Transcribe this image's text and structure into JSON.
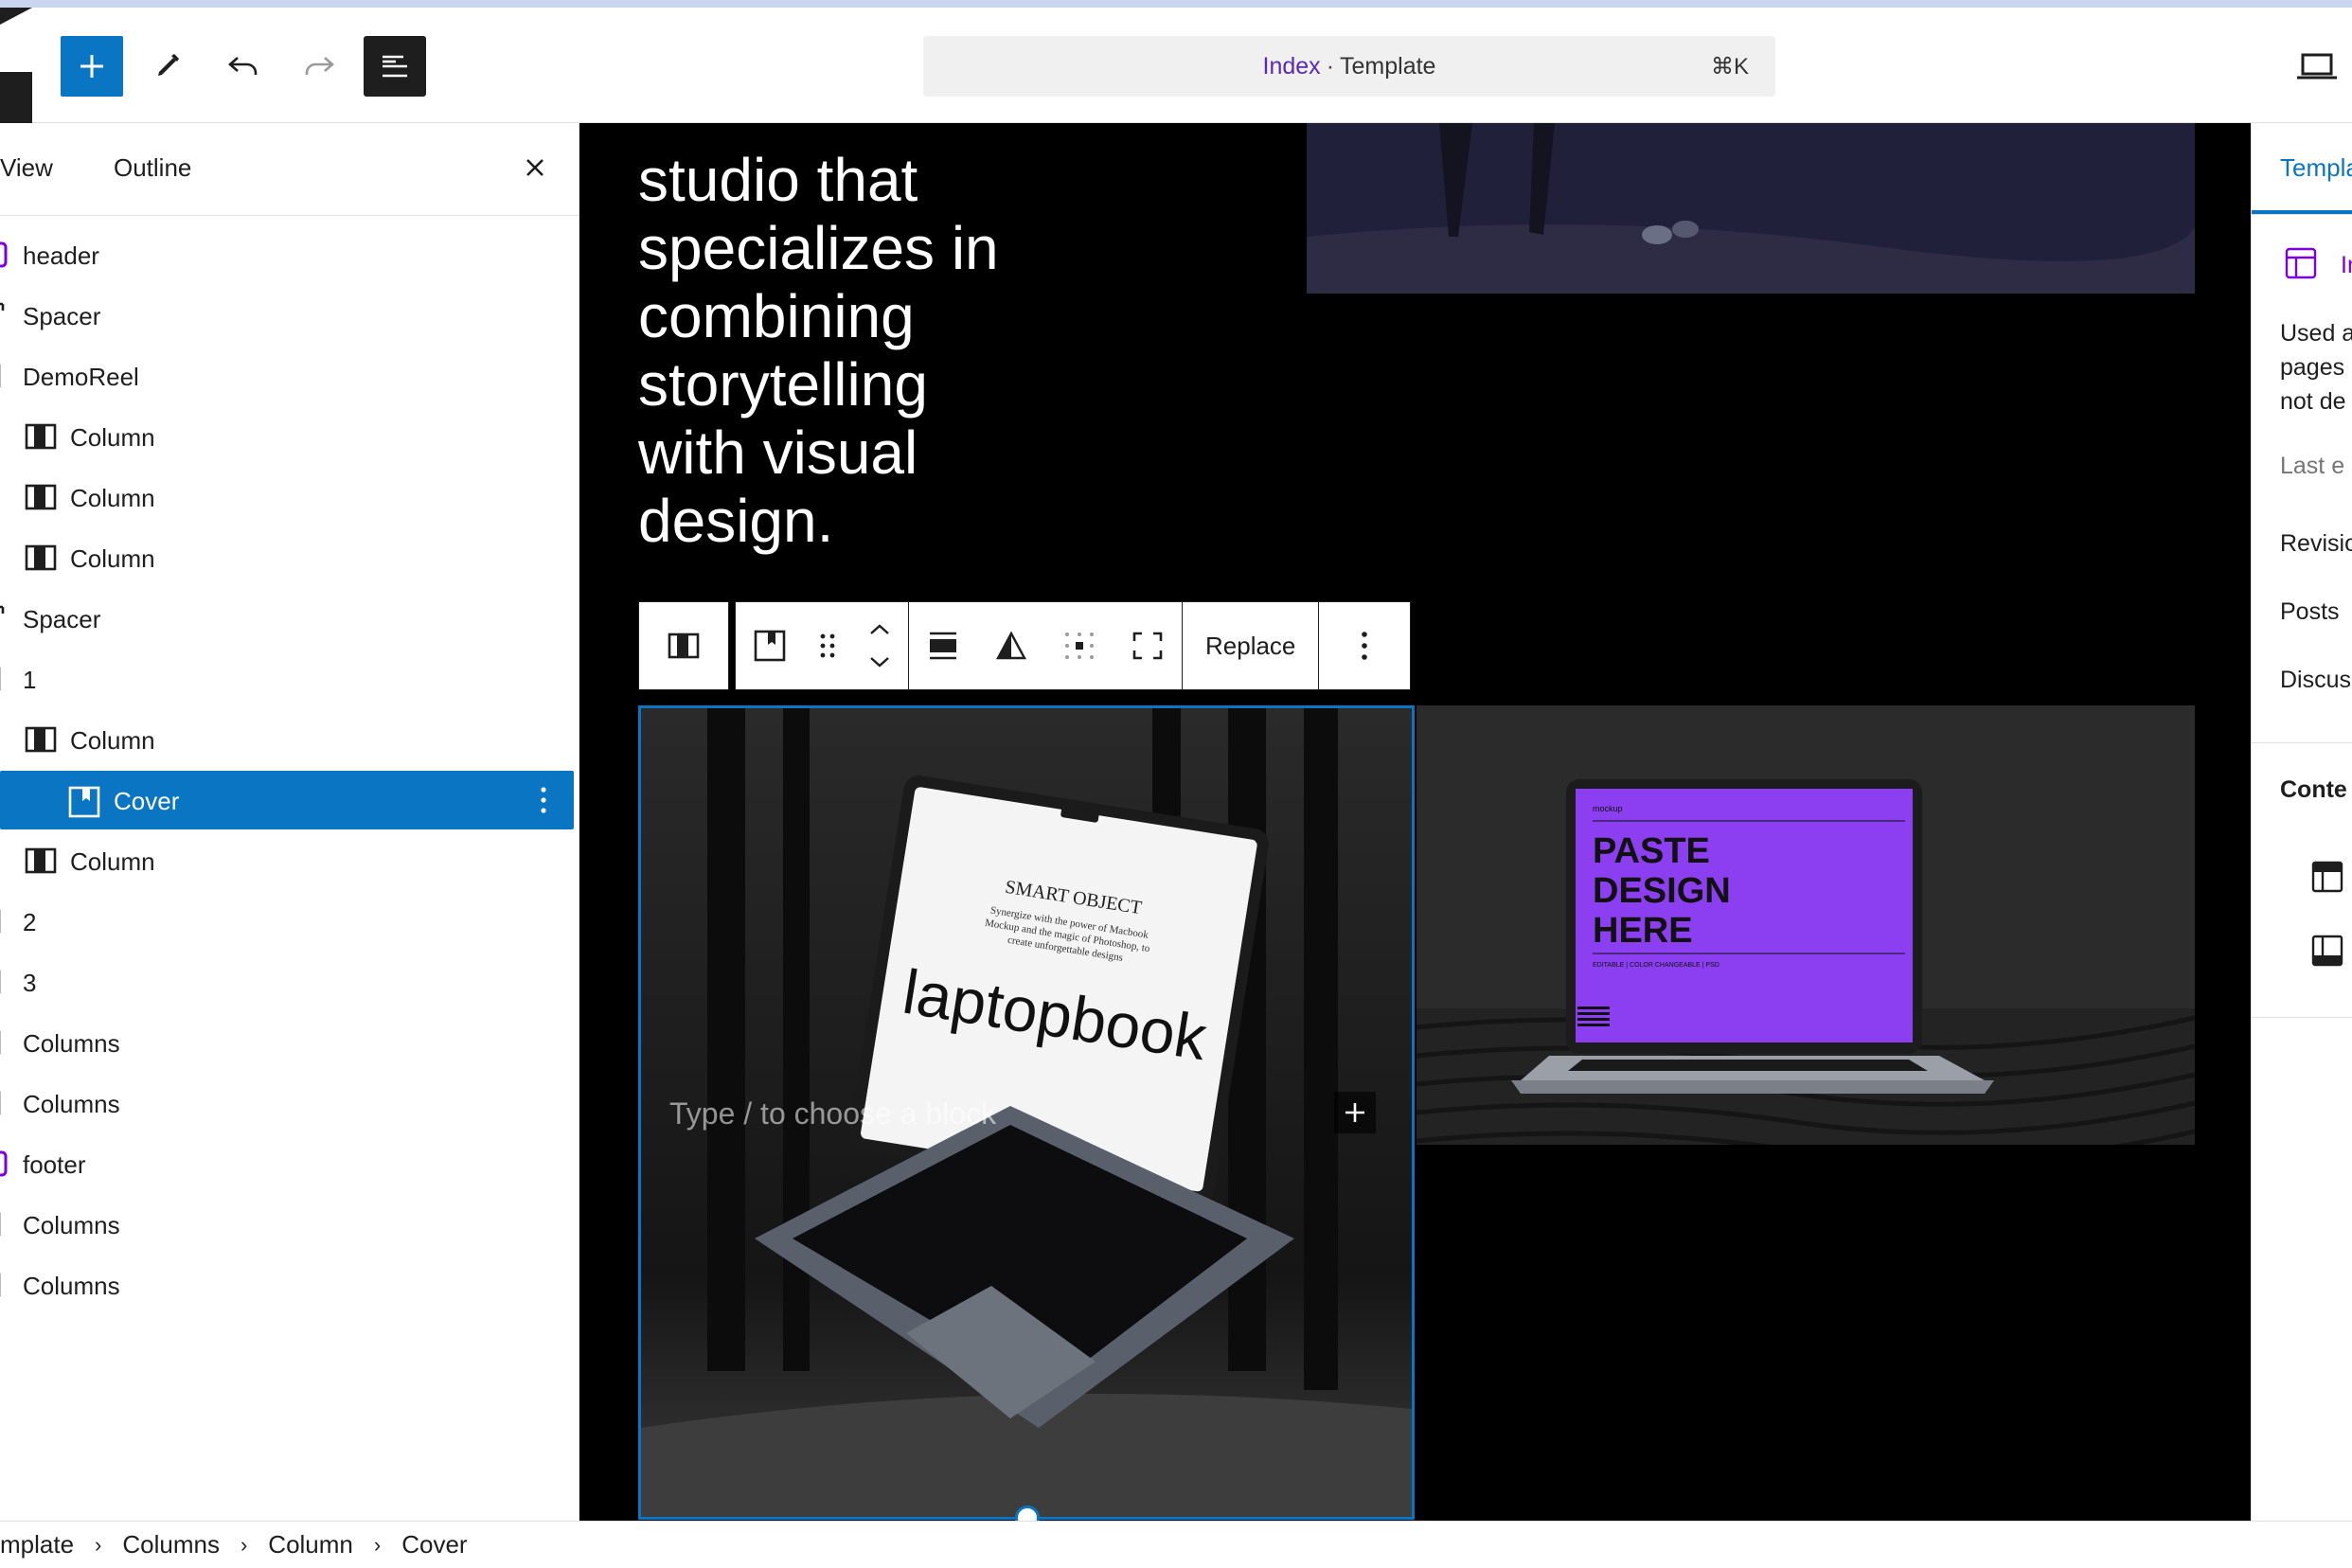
{
  "header": {
    "doc_title": "Index",
    "doc_sep": "·",
    "doc_type": "Template",
    "shortcut": "⌘K"
  },
  "list_panel": {
    "tab_list": "View",
    "tab_outline": "Outline",
    "items": [
      {
        "label": "header",
        "icon": "template-part-icon",
        "level": 0
      },
      {
        "label": "Spacer",
        "icon": "spacer-icon",
        "level": 0
      },
      {
        "label": "DemoReel",
        "icon": "group-icon",
        "level": 0
      },
      {
        "label": "Column",
        "icon": "column-icon",
        "level": 1
      },
      {
        "label": "Column",
        "icon": "column-icon",
        "level": 1
      },
      {
        "label": "Column",
        "icon": "column-icon",
        "level": 1
      },
      {
        "label": "Spacer",
        "icon": "spacer-icon",
        "level": 0
      },
      {
        "label": "1",
        "icon": "group-icon",
        "level": 0
      },
      {
        "label": "Column",
        "icon": "column-icon",
        "level": 1
      },
      {
        "label": "Cover",
        "icon": "cover-icon",
        "level": 2,
        "selected": true
      },
      {
        "label": "Column",
        "icon": "column-icon",
        "level": 1
      },
      {
        "label": "2",
        "icon": "group-icon",
        "level": 0
      },
      {
        "label": "3",
        "icon": "group-icon",
        "level": 0
      },
      {
        "label": "Columns",
        "icon": "columns-icon",
        "level": 0
      },
      {
        "label": "Columns",
        "icon": "columns-icon",
        "level": 0
      },
      {
        "label": "footer",
        "icon": "template-part-icon",
        "level": 0
      },
      {
        "label": "Columns",
        "icon": "columns-icon",
        "level": 0
      },
      {
        "label": "Columns",
        "icon": "columns-icon",
        "level": 0
      }
    ]
  },
  "canvas": {
    "hero_lines": [
      "studio that",
      "specializes in",
      "combining",
      "storytelling",
      "with visual",
      "design."
    ],
    "block_toolbar": {
      "replace_label": "Replace"
    },
    "cover_placeholder": "Type / to choose a block",
    "laptop_left": {
      "headline": "SMART OBJECT",
      "subtext": "Synergize with the power of Macbook Mockup and the magic of Photoshop, to create unforgettable designs",
      "brand": "laptopbook"
    },
    "laptop_right": {
      "small": "mockup",
      "line1": "PASTE",
      "line2": "DESIGN",
      "line3": "HERE",
      "fine": "EDITABLE | COLOR CHANGEABLE | PSD"
    }
  },
  "settings_panel": {
    "tab": "Template",
    "template_name": "Index",
    "desc_line1": "Used as",
    "desc_line2": "pages",
    "desc_line3": "not de",
    "last_edited": "Last e",
    "revisions": "Revisio",
    "posts": "Posts",
    "discussion": "Discus",
    "content_heading": "Conte"
  },
  "breadcrumb": {
    "items": [
      "mplate",
      "Columns",
      "Column",
      "Cover"
    ],
    "separator": "›"
  },
  "colors": {
    "accent": "#0a75c2",
    "template_part": "#7a00df",
    "canvas_bg": "#000000",
    "purple_screen": "#8b3ff0"
  }
}
